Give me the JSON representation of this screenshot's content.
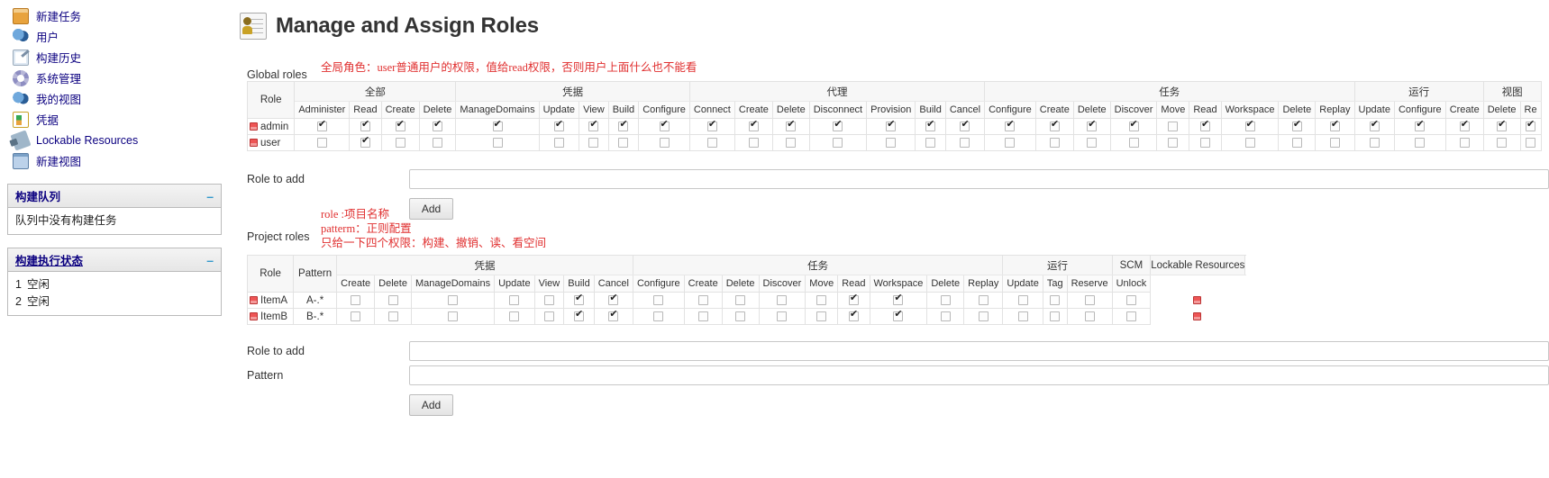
{
  "sidebar": {
    "nav": [
      {
        "label": "新建任务",
        "icon": "folder-new-icon"
      },
      {
        "label": "用户",
        "icon": "users-icon"
      },
      {
        "label": "构建历史",
        "icon": "build-history-icon"
      },
      {
        "label": "系统管理",
        "icon": "gear-icon"
      },
      {
        "label": "我的视图",
        "icon": "my-views-icon"
      },
      {
        "label": "凭据",
        "icon": "credentials-icon"
      },
      {
        "label": "Lockable Resources",
        "icon": "lock-icon"
      },
      {
        "label": "新建视图",
        "icon": "new-view-icon"
      }
    ],
    "build_queue": {
      "title": "构建队列",
      "collapse_icon": "minus-icon",
      "empty_text": "队列中没有构建任务"
    },
    "build_executor": {
      "title": "构建执行状态",
      "collapse_icon": "minus-icon",
      "executors": [
        {
          "num": "1",
          "status": "空闲"
        },
        {
          "num": "2",
          "status": "空闲"
        }
      ]
    }
  },
  "header": {
    "title": "Manage and Assign Roles",
    "icon": "roles-badge-icon"
  },
  "annotations": {
    "global": "全局角色：user普通用户的权限，值给read权限，否则用户上面什么也不能看",
    "project_line1": "role  :项目名称",
    "project_line2": "patterm：正则配置",
    "project_line3": "只给一下四个权限：构建、撤销、读、看空间"
  },
  "global_roles": {
    "label": "Global roles",
    "role_col": "Role",
    "groups": [
      {
        "name": "全部",
        "span": 4
      },
      {
        "name": "凭据",
        "span": 5
      },
      {
        "name": "代理",
        "span": 7
      },
      {
        "name": "任务",
        "span": 9
      },
      {
        "name": "运行",
        "span": 3
      },
      {
        "name": "视图",
        "span": 4
      }
    ],
    "columns": [
      "Administer",
      "Read",
      "Create",
      "Delete",
      "ManageDomains",
      "Update",
      "View",
      "Build",
      "Configure",
      "Connect",
      "Create",
      "Delete",
      "Disconnect",
      "Provision",
      "Build",
      "Cancel",
      "Configure",
      "Create",
      "Delete",
      "Discover",
      "Move",
      "Read",
      "Workspace",
      "Delete",
      "Replay",
      "Update",
      "Configure",
      "Create",
      "Delete",
      "Re"
    ],
    "rows": [
      {
        "name": "admin",
        "delete_icon": "delete-role-icon",
        "checks": [
          true,
          true,
          true,
          true,
          true,
          true,
          true,
          true,
          true,
          true,
          true,
          true,
          true,
          true,
          true,
          true,
          true,
          true,
          true,
          true,
          false,
          true,
          true,
          true,
          true,
          true,
          true,
          true,
          true,
          true
        ]
      },
      {
        "name": "user",
        "delete_icon": "delete-role-icon",
        "checks": [
          false,
          true,
          false,
          false,
          false,
          false,
          false,
          false,
          false,
          false,
          false,
          false,
          false,
          false,
          false,
          false,
          false,
          false,
          false,
          false,
          false,
          false,
          false,
          false,
          false,
          false,
          false,
          false,
          false,
          false
        ]
      }
    ]
  },
  "global_add": {
    "label": "Role to add",
    "value": "",
    "placeholder": "",
    "add_button": "Add"
  },
  "project_roles": {
    "label": "Project roles",
    "role_col": "Role",
    "pattern_col": "Pattern",
    "groups": [
      {
        "name": "凭据",
        "span": 7
      },
      {
        "name": "任务",
        "span": 9
      },
      {
        "name": "运行",
        "span": 3
      },
      {
        "name": "SCM",
        "span": 1
      },
      {
        "name": "Lockable Resources",
        "span": 2
      }
    ],
    "columns": [
      "Create",
      "Delete",
      "ManageDomains",
      "Update",
      "View",
      "Build",
      "Cancel",
      "Configure",
      "Create",
      "Delete",
      "Discover",
      "Move",
      "Read",
      "Workspace",
      "Delete",
      "Replay",
      "Update",
      "Tag",
      "Reserve",
      "Unlock"
    ],
    "rows": [
      {
        "name": "ItemA",
        "pattern": "A-.*",
        "delete_icon": "delete-role-icon",
        "row_delete_icon": "delete-row-icon",
        "checks": [
          false,
          false,
          false,
          false,
          false,
          true,
          true,
          false,
          false,
          false,
          false,
          false,
          true,
          true,
          false,
          false,
          false,
          false,
          false,
          false
        ]
      },
      {
        "name": "ItemB",
        "pattern": "B-.*",
        "delete_icon": "delete-role-icon",
        "row_delete_icon": "delete-row-icon",
        "checks": [
          false,
          false,
          false,
          false,
          false,
          true,
          true,
          false,
          false,
          false,
          false,
          false,
          true,
          true,
          false,
          false,
          false,
          false,
          false,
          false
        ]
      }
    ]
  },
  "project_add": {
    "role_label": "Role to add",
    "role_value": "",
    "pattern_label": "Pattern",
    "pattern_value": "",
    "add_button": "Add"
  },
  "colors": {
    "link": "#0b0080",
    "note": "#e03030",
    "delete": "#e55555"
  }
}
